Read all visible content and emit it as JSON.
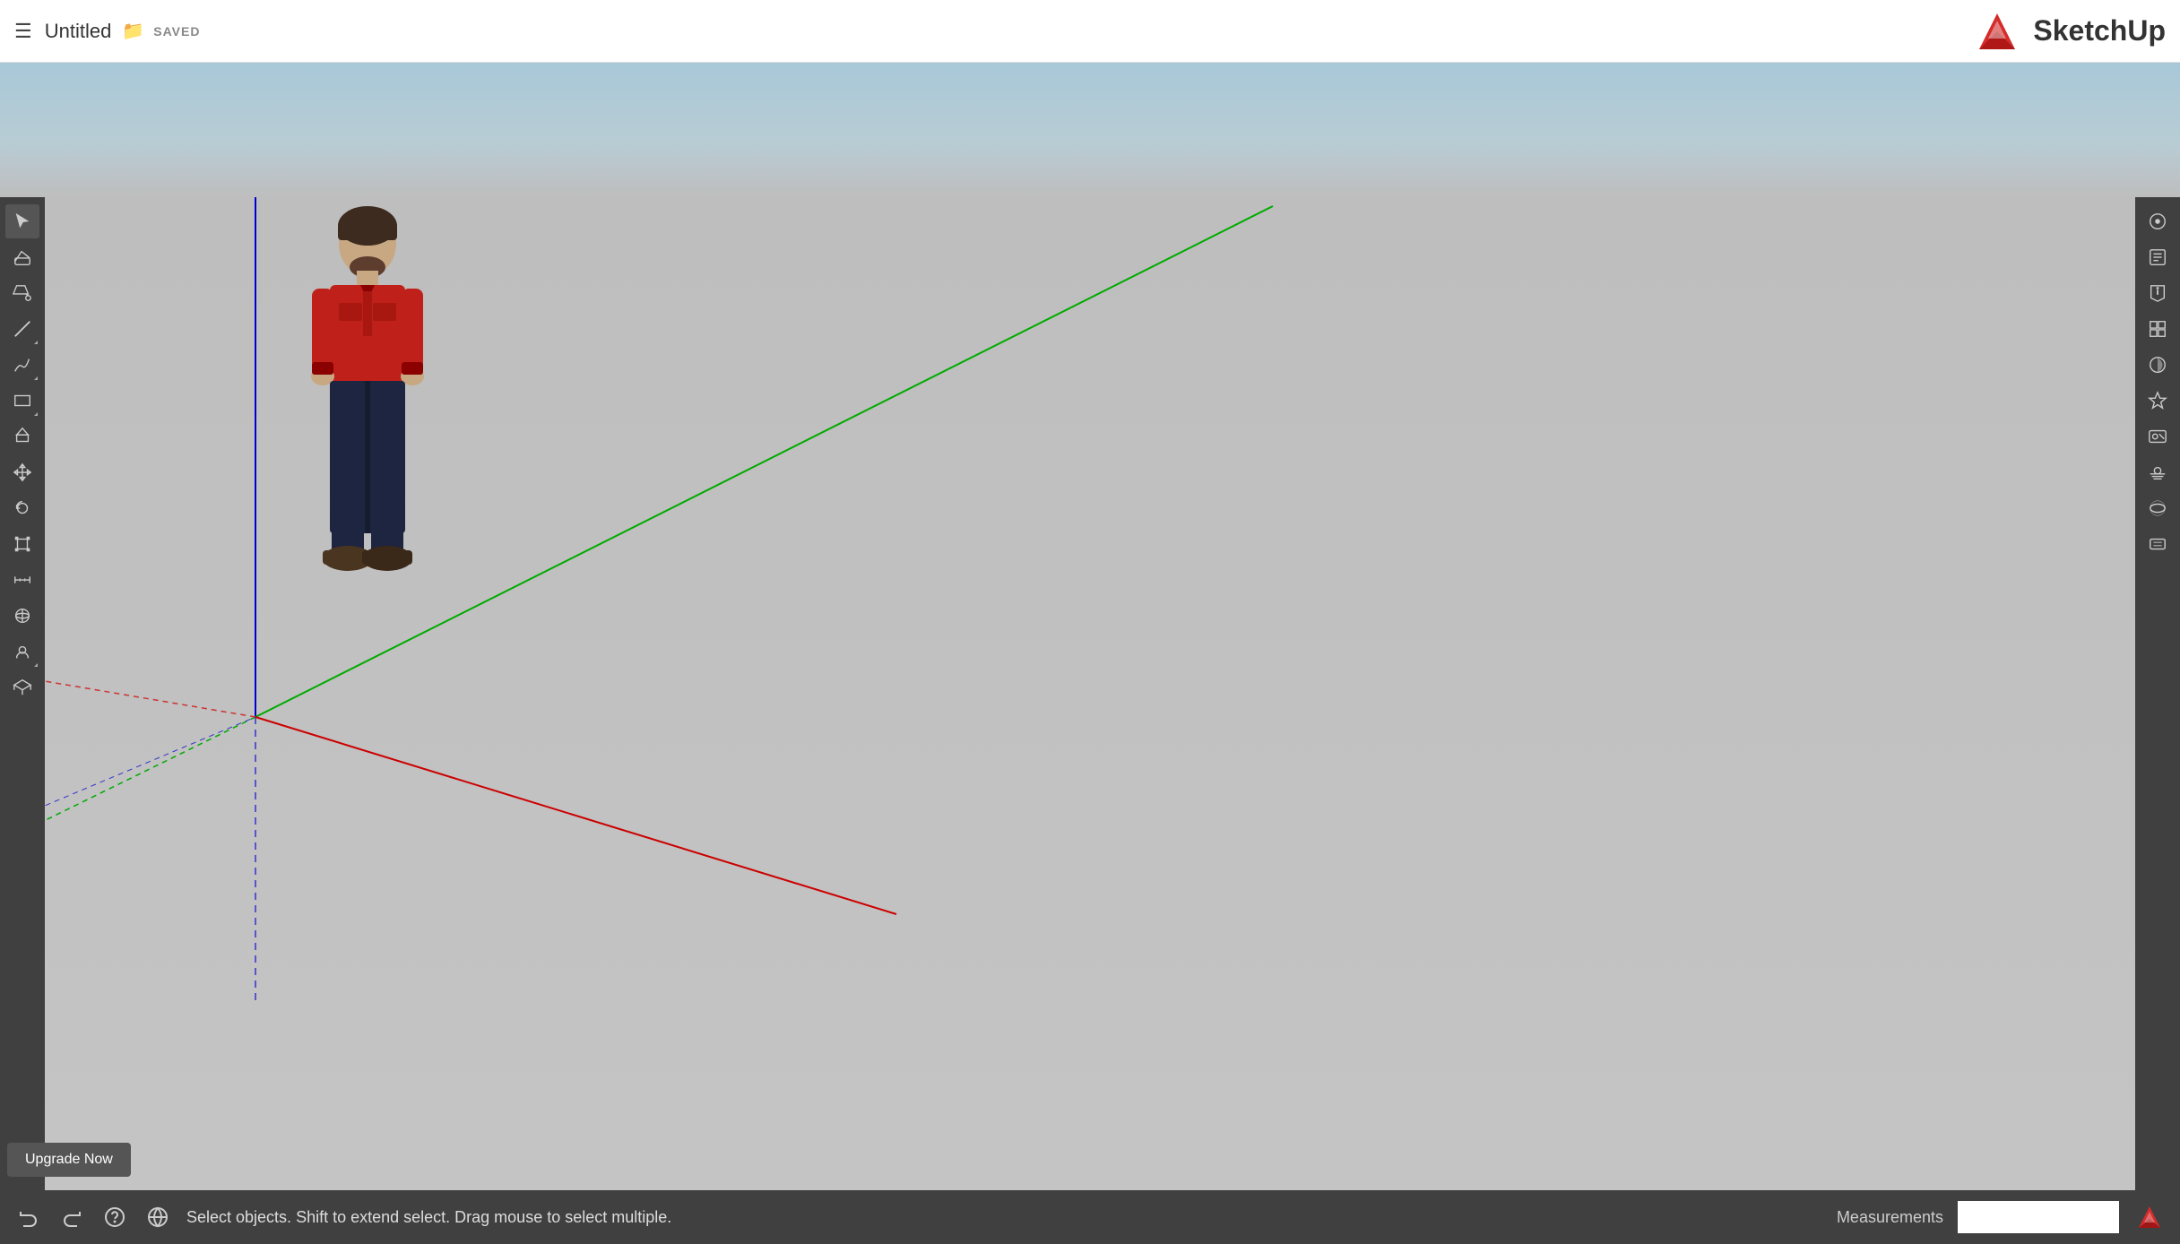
{
  "topbar": {
    "menu_icon": "≡",
    "title": "Untitled",
    "saved_label": "SAVED",
    "logo_text": "SketchUp"
  },
  "left_toolbar": {
    "tools": [
      {
        "name": "select",
        "label": "Select"
      },
      {
        "name": "eraser",
        "label": "Eraser"
      },
      {
        "name": "paint-bucket",
        "label": "Paint Bucket"
      },
      {
        "name": "line",
        "label": "Line",
        "has_arrow": true
      },
      {
        "name": "freehand",
        "label": "Freehand",
        "has_arrow": true
      },
      {
        "name": "rectangle",
        "label": "Rectangle",
        "has_arrow": true
      },
      {
        "name": "push-pull",
        "label": "Push/Pull"
      },
      {
        "name": "move",
        "label": "Move"
      },
      {
        "name": "rotate",
        "label": "Rotate"
      },
      {
        "name": "scale",
        "label": "Scale"
      },
      {
        "name": "tape-measure",
        "label": "Tape Measure"
      },
      {
        "name": "orbit",
        "label": "Orbit"
      },
      {
        "name": "look-around",
        "label": "Look Around",
        "has_arrow": true
      },
      {
        "name": "section-plane",
        "label": "Section Plane"
      }
    ]
  },
  "right_toolbar": {
    "tools": [
      {
        "name": "default-tray",
        "label": "Default Tray"
      },
      {
        "name": "entity-info",
        "label": "Entity Info"
      },
      {
        "name": "instructor",
        "label": "Instructor"
      },
      {
        "name": "components",
        "label": "Components"
      },
      {
        "name": "materials",
        "label": "Materials"
      },
      {
        "name": "styles",
        "label": "Styles"
      },
      {
        "name": "scenes",
        "label": "Scenes"
      },
      {
        "name": "fog",
        "label": "Fog"
      },
      {
        "name": "match-photo",
        "label": "Match Photo"
      },
      {
        "name": "soften-edges",
        "label": "Soften Edges"
      }
    ]
  },
  "status_bar": {
    "undo_icon": "↩",
    "redo_icon": "↪",
    "help_icon": "?",
    "location_icon": "⊕",
    "status_text": "Select objects. Shift to extend select. Drag mouse to select multiple.",
    "measurements_label": "Measurements"
  },
  "upgrade_btn": {
    "label": "Upgrade Now"
  },
  "canvas": {
    "axes": {
      "blue_axis": {
        "color": "#0000cc"
      },
      "green_axis": {
        "color": "#00aa00"
      },
      "red_axis": {
        "color": "#cc0000"
      },
      "green_dotted": {
        "color": "#00aa00"
      },
      "red_dotted": {
        "color": "#cc3333"
      },
      "blue_dotted": {
        "color": "#3333cc"
      }
    }
  }
}
